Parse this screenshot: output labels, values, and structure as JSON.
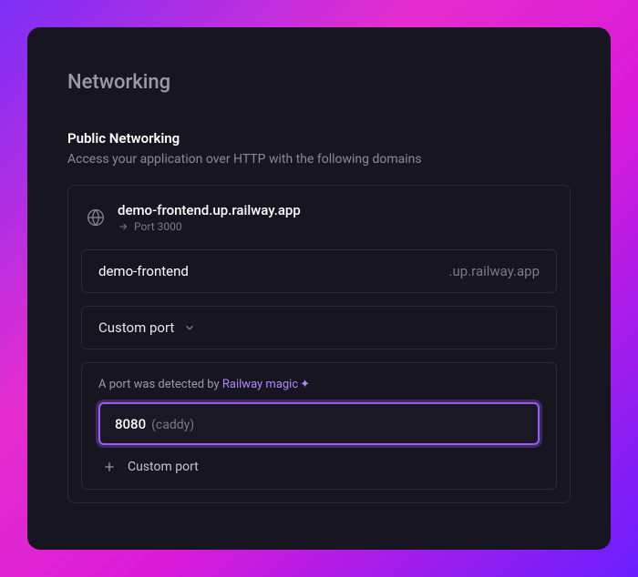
{
  "page": {
    "title": "Networking"
  },
  "section": {
    "title": "Public Networking",
    "description": "Access your application over HTTP with the following domains"
  },
  "domain": {
    "name": "demo-frontend.up.railway.app",
    "port_label": "Port 3000"
  },
  "subdomain": {
    "value": "demo-frontend",
    "suffix": ".up.railway.app"
  },
  "port_select": {
    "label": "Custom port"
  },
  "detection": {
    "prefix": "A port was detected by ",
    "magic": "Railway magic",
    "sparkle": "✦"
  },
  "detected_port": {
    "number": "8080",
    "label": "(caddy)"
  },
  "custom_port": {
    "label": "Custom port"
  }
}
